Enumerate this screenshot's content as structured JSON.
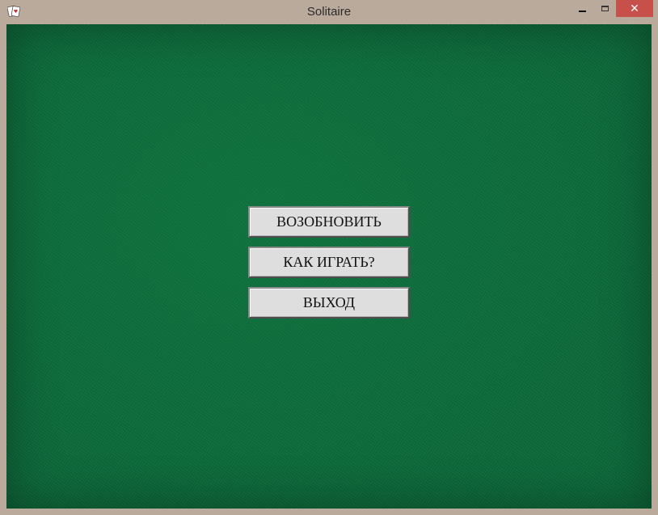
{
  "window": {
    "title": "Solitaire",
    "close_glyph": "✕",
    "icons": {
      "app": "solitaire-cards-icon",
      "minimize": "minimize-icon",
      "maximize": "maximize-icon",
      "close": "close-icon"
    },
    "colors": {
      "frame": "#b9aa9b",
      "close_button": "#c7504a",
      "felt": "#0b6b3a"
    }
  },
  "menu": {
    "resume_label": "ВОЗОБНОВИТЬ",
    "how_to_play_label": "КАК ИГРАТЬ?",
    "exit_label": "ВЫХОД"
  }
}
